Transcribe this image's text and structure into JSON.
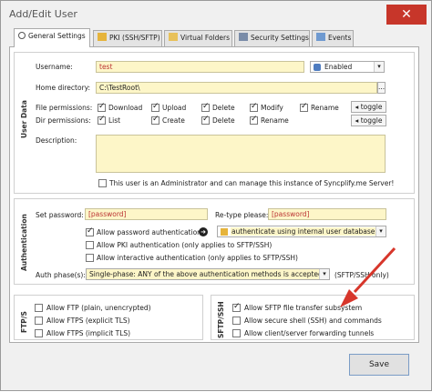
{
  "window": {
    "title": "Add/Edit User",
    "close_glyph": "✕"
  },
  "tabs": [
    {
      "label": "General Settings",
      "icon": "settings-icon"
    },
    {
      "label": "PKI (SSH/SFTP)",
      "icon": "key-icon"
    },
    {
      "label": "Virtual Folders",
      "icon": "folder-icon"
    },
    {
      "label": "Security Settings",
      "icon": "shield-icon"
    },
    {
      "label": "Events",
      "icon": "events-icon"
    }
  ],
  "user_data": {
    "section_label": "User Data",
    "username_label": "Username:",
    "username_value": "test",
    "status_value": "Enabled",
    "home_label": "Home directory:",
    "home_value": "C:\\TestRoot\\",
    "browse_label": "...",
    "file_perm_label": "File permissions:",
    "dir_perm_label": "Dir permissions:",
    "file_perms": [
      "Download",
      "Upload",
      "Delete",
      "Modify",
      "Rename"
    ],
    "dir_perms": [
      "List",
      "Create",
      "Delete",
      "Rename"
    ],
    "toggle_label": "toggle",
    "description_label": "Description:",
    "admin_label": "This user is an Administrator and can manage this instance of Syncplify.me Server!"
  },
  "auth": {
    "section_label": "Authentication",
    "set_password_label": "Set password:",
    "set_password_value": "[password]",
    "retype_label": "Re-type please:",
    "retype_value": "[password]",
    "allow_password": "Allow password authentication",
    "auth_method": "authenticate using internal user database",
    "allow_pki": "Allow PKI authentication (only applies to SFTP/SSH)",
    "allow_interactive": "Allow interactive authentication (only applies to SFTP/SSH)",
    "phase_label": "Auth phase(s):",
    "phase_value": "Single-phase: ANY of the above authentication methods is accepted",
    "phase_note": "(SFTP/SSH only)"
  },
  "ftps": {
    "section_label": "FTP/S",
    "items": [
      "Allow FTP (plain, unencrypted)",
      "Allow FTPS (explicit TLS)",
      "Allow FTPS (implicit TLS)"
    ]
  },
  "sftp": {
    "section_label": "SFTP/SSH",
    "items": [
      "Allow SFTP file transfer subsystem",
      "Allow secure shell (SSH) and commands",
      "Allow client/server forwarding tunnels"
    ]
  },
  "save_label": "Save",
  "colors": {
    "accent_red": "#d7362b",
    "field_yellow": "#fdf6c8",
    "close_red": "#c7362a"
  }
}
